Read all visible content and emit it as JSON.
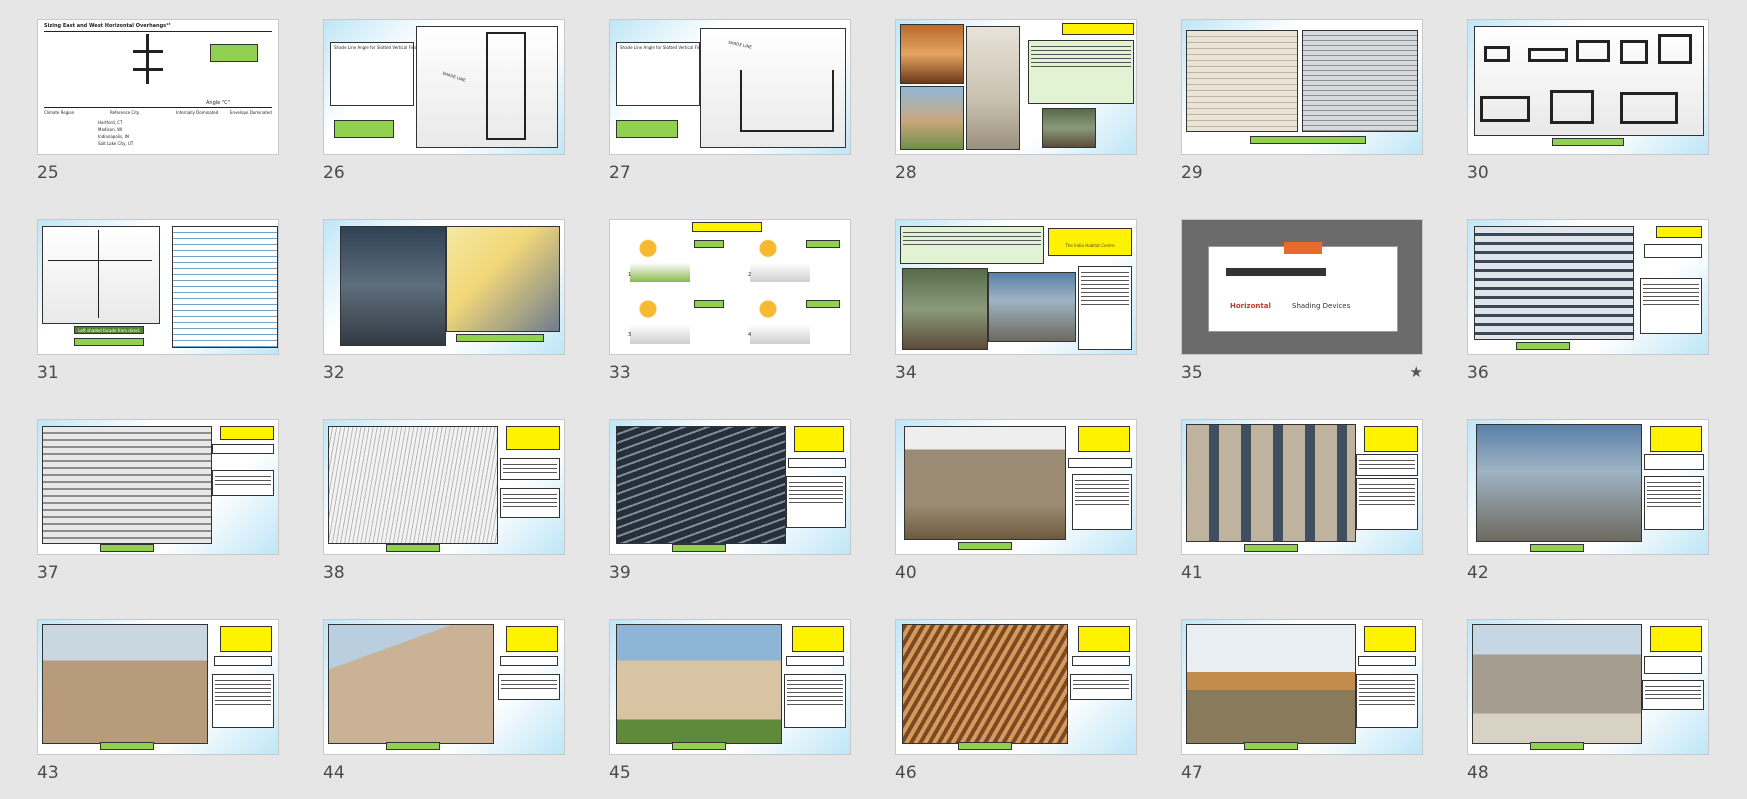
{
  "slides": [
    {
      "n": "25",
      "kind": "diagram1",
      "texts": [
        "Sizing East and West Horizontal Overhangs¹³",
        "Angle \"C\"",
        "Climate Region",
        "Reference City",
        "Internally Dominated",
        "Envelope Dominated",
        "Hartford, CT",
        "Madison, WI",
        "Indianapolis, IN",
        "Salt Lake City, UT"
      ]
    },
    {
      "n": "26",
      "kind": "diagram2",
      "texts": [
        "Shade Line Angle for Slotted Vertical Fins",
        "SHADE LINE"
      ]
    },
    {
      "n": "27",
      "kind": "diagram3",
      "texts": [
        "Shade Line Angle for Slotted Vertical Fins",
        "SHADE LINE"
      ]
    },
    {
      "n": "28",
      "kind": "photos4"
    },
    {
      "n": "29",
      "kind": "photos2"
    },
    {
      "n": "30",
      "kind": "shapes"
    },
    {
      "n": "31",
      "kind": "drawings",
      "texts": [
        "Left shaded facade from direct sun"
      ]
    },
    {
      "n": "32",
      "kind": "photos2b"
    },
    {
      "n": "33",
      "kind": "cartoon",
      "texts": [
        "1",
        "2",
        "3",
        "4"
      ]
    },
    {
      "n": "34",
      "kind": "intro",
      "texts": [
        "The India Habitat Centre"
      ]
    },
    {
      "n": "35",
      "kind": "section",
      "star": "★",
      "texts": [
        "Horizontal",
        "Shading Devices"
      ]
    },
    {
      "n": "36",
      "kind": "photoText"
    },
    {
      "n": "37",
      "kind": "photoText"
    },
    {
      "n": "38",
      "kind": "photoText"
    },
    {
      "n": "39",
      "kind": "photoText"
    },
    {
      "n": "40",
      "kind": "photoText"
    },
    {
      "n": "41",
      "kind": "photoText"
    },
    {
      "n": "42",
      "kind": "photoText"
    },
    {
      "n": "43",
      "kind": "photoText"
    },
    {
      "n": "44",
      "kind": "photoText"
    },
    {
      "n": "45",
      "kind": "photoText"
    },
    {
      "n": "46",
      "kind": "photoText"
    },
    {
      "n": "47",
      "kind": "photoText"
    },
    {
      "n": "48",
      "kind": "photoText"
    }
  ]
}
